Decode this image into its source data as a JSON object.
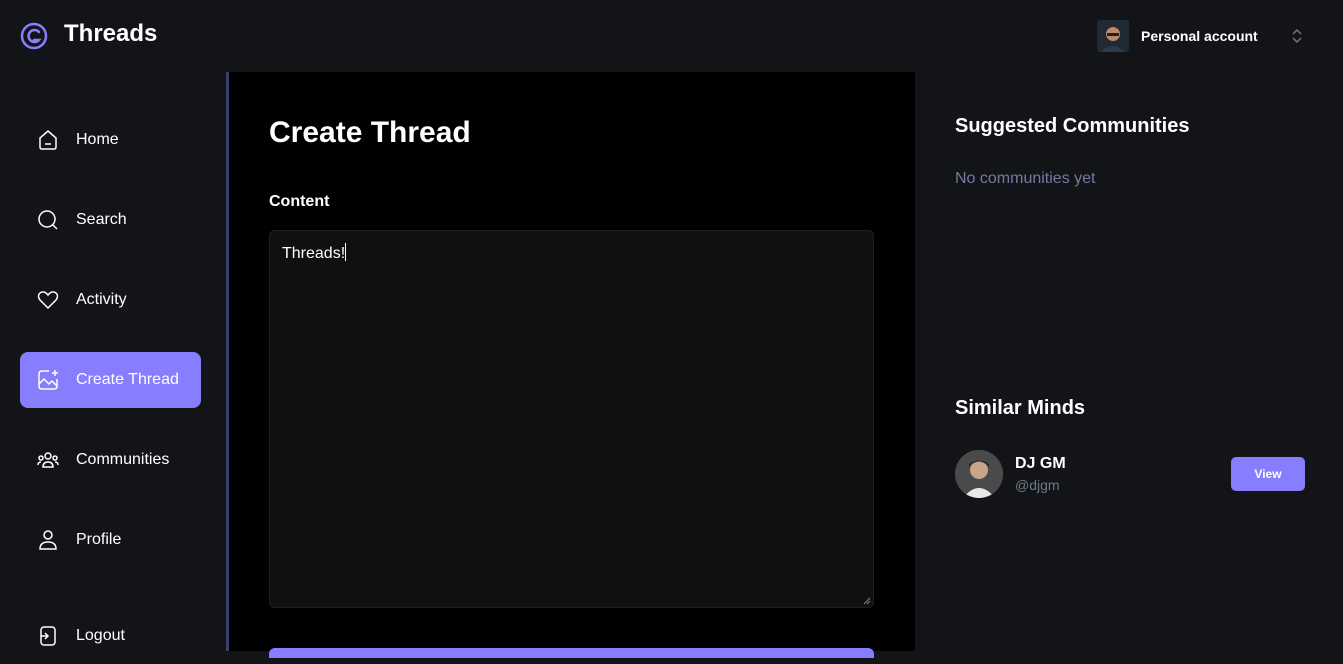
{
  "app": {
    "title": "Threads",
    "accent": "#877eff"
  },
  "account": {
    "label": "Personal account"
  },
  "sidebar": {
    "items": [
      {
        "label": "Home",
        "icon": "home-icon"
      },
      {
        "label": "Search",
        "icon": "search-icon"
      },
      {
        "label": "Activity",
        "icon": "heart-icon"
      },
      {
        "label": "Create Thread",
        "icon": "create-icon",
        "active": true
      },
      {
        "label": "Communities",
        "icon": "communities-icon"
      },
      {
        "label": "Profile",
        "icon": "user-icon"
      }
    ],
    "logout": {
      "label": "Logout",
      "icon": "logout-icon"
    }
  },
  "main": {
    "title": "Create Thread",
    "content_label": "Content",
    "content_value": "Threads!"
  },
  "rightbar": {
    "suggested": {
      "title": "Suggested Communities",
      "empty": "No communities yet"
    },
    "similar": {
      "title": "Similar Minds",
      "users": [
        {
          "name": "DJ GM",
          "handle": "@djgm",
          "action": "View"
        }
      ]
    }
  }
}
